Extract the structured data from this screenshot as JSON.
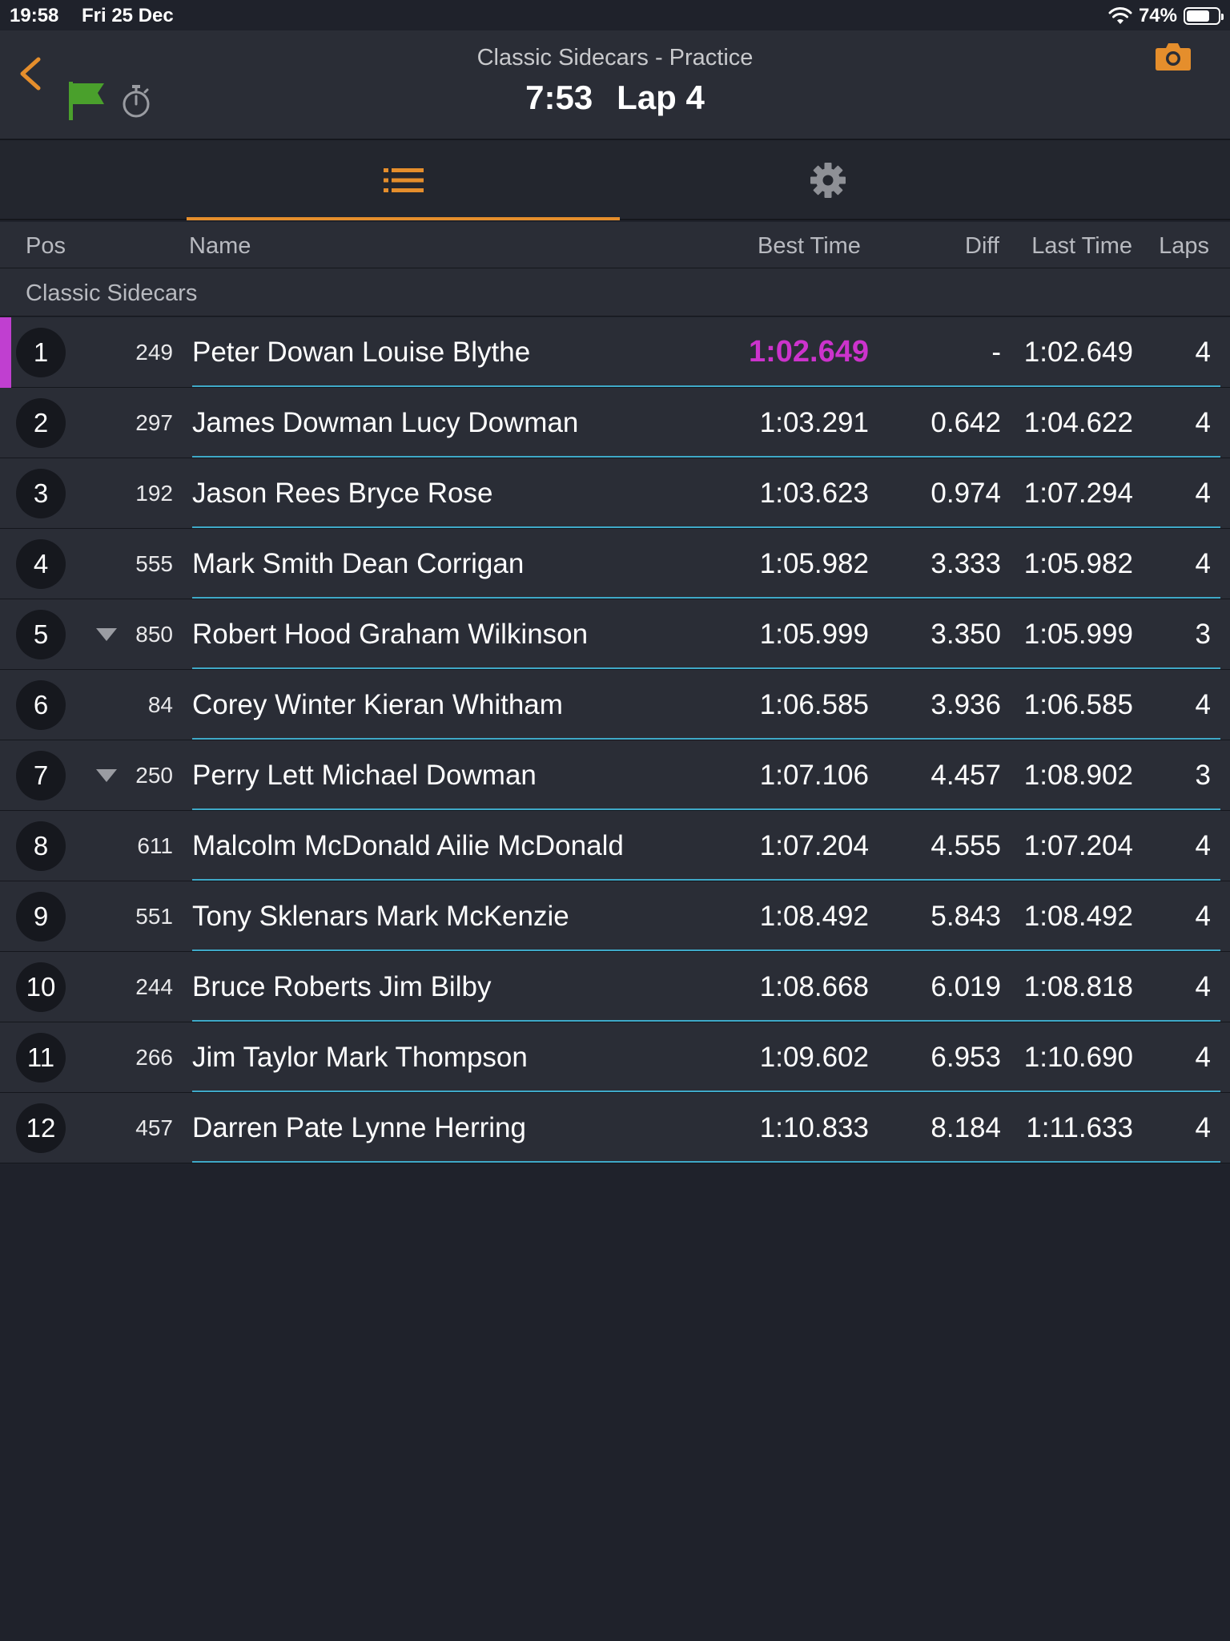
{
  "status_bar": {
    "time": "19:58",
    "date": "Fri 25 Dec",
    "battery": "74%",
    "battery_level": 0.74
  },
  "header": {
    "title": "Classic Sidecars - Practice",
    "elapsed": "7:53",
    "lap": "Lap 4"
  },
  "columns": {
    "pos": "Pos",
    "name": "Name",
    "best_time": "Best Time",
    "diff": "Diff",
    "last_time": "Last Time",
    "laps": "Laps"
  },
  "class_name": "Classic Sidecars",
  "colors": {
    "accent": "#e58e2c",
    "fastest": "#cc33cc",
    "flag": "#4aa02c",
    "divider": "#3fa9c8"
  },
  "rows": [
    {
      "pos": "1",
      "number": "249",
      "name": "Peter Dowan Louise Blythe",
      "best": "1:02.649",
      "diff": "-",
      "last": "1:02.649",
      "laps": "4"
    },
    {
      "pos": "2",
      "number": "297",
      "name": "James Dowman Lucy Dowman",
      "best": "1:03.291",
      "diff": "0.642",
      "last": "1:04.622",
      "laps": "4"
    },
    {
      "pos": "3",
      "number": "192",
      "name": "Jason Rees Bryce Rose",
      "best": "1:03.623",
      "diff": "0.974",
      "last": "1:07.294",
      "laps": "4"
    },
    {
      "pos": "4",
      "number": "555",
      "name": "Mark Smith Dean Corrigan",
      "best": "1:05.982",
      "diff": "3.333",
      "last": "1:05.982",
      "laps": "4"
    },
    {
      "pos": "5",
      "number": "850",
      "name": "Robert Hood Graham Wilkinson",
      "best": "1:05.999",
      "diff": "3.350",
      "last": "1:05.999",
      "laps": "3"
    },
    {
      "pos": "6",
      "number": "84",
      "name": "Corey Winter Kieran Whitham",
      "best": "1:06.585",
      "diff": "3.936",
      "last": "1:06.585",
      "laps": "4"
    },
    {
      "pos": "7",
      "number": "250",
      "name": "Perry Lett Michael Dowman",
      "best": "1:07.106",
      "diff": "4.457",
      "last": "1:08.902",
      "laps": "3"
    },
    {
      "pos": "8",
      "number": "611",
      "name": "Malcolm McDonald Ailie McDonald",
      "best": "1:07.204",
      "diff": "4.555",
      "last": "1:07.204",
      "laps": "4"
    },
    {
      "pos": "9",
      "number": "551",
      "name": "Tony Sklenars Mark McKenzie",
      "best": "1:08.492",
      "diff": "5.843",
      "last": "1:08.492",
      "laps": "4"
    },
    {
      "pos": "10",
      "number": "244",
      "name": "Bruce Roberts Jim Bilby",
      "best": "1:08.668",
      "diff": "6.019",
      "last": "1:08.818",
      "laps": "4"
    },
    {
      "pos": "11",
      "number": "266",
      "name": "Jim Taylor Mark Thompson",
      "best": "1:09.602",
      "diff": "6.953",
      "last": "1:10.690",
      "laps": "4"
    },
    {
      "pos": "12",
      "number": "457",
      "name": "Darren Pate Lynne Herring",
      "best": "1:10.833",
      "diff": "8.184",
      "last": "1:11.633",
      "laps": "4"
    }
  ]
}
